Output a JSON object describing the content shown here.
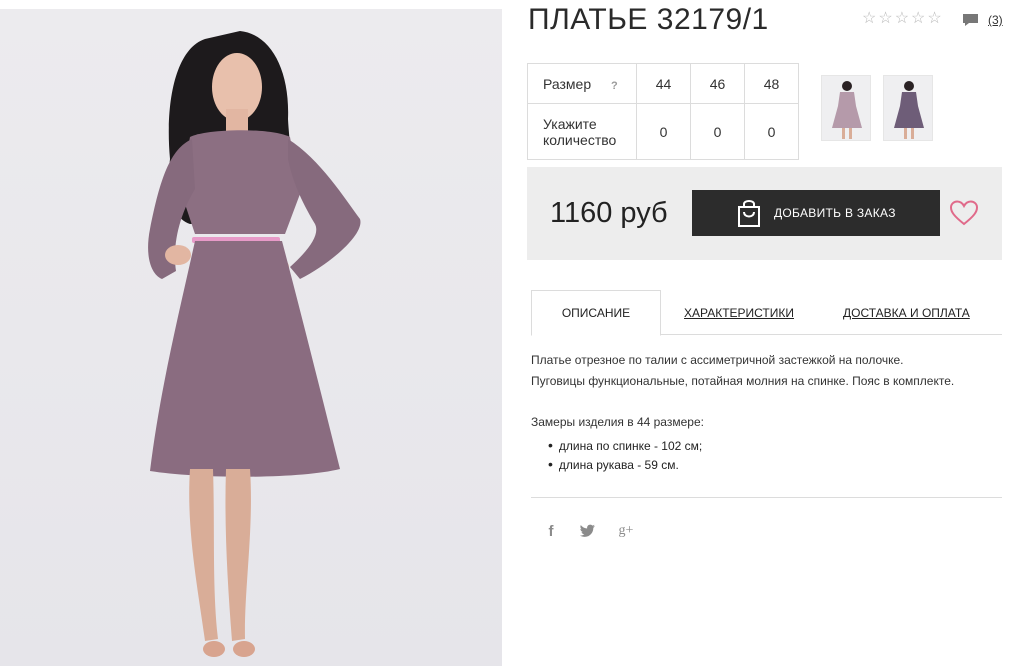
{
  "product": {
    "title": "ПЛАТЬЕ 32179/1",
    "review_count": "(3)"
  },
  "rating": {
    "value": 0,
    "max": 5,
    "star_glyph": "☆"
  },
  "size_table": {
    "size_label": "Размер",
    "help_label": "?",
    "quantity_label_line1": "Укажите",
    "quantity_label_line2": "количество",
    "sizes": [
      "44",
      "46",
      "48"
    ],
    "quantities": [
      "0",
      "0",
      "0"
    ]
  },
  "buy": {
    "price": "1160 руб",
    "add_button_label": "ДОБАВИТЬ В ЗАКАЗ"
  },
  "tabs": [
    {
      "label": "ОПИСАНИЕ",
      "active": true
    },
    {
      "label": "ХАРАКТЕРИСТИКИ",
      "active": false
    },
    {
      "label": "ДОСТАВКА И ОПЛАТА",
      "active": false
    }
  ],
  "description": {
    "line1": "Платье отрезное по талии с ассиметричной застежкой на полочке.",
    "line2": "Пуговицы функциональные, потайная молния на спинке. Пояс в комплекте.",
    "measurements_title": "Замеры изделия в 44 размере:",
    "measurements": [
      "длина по спинке - 102 см;",
      "длина рукава - 59 см."
    ]
  },
  "social": {
    "facebook": "f",
    "googleplus": "g+"
  },
  "colors": {
    "dress": "#8c6f82",
    "belt": "#e79ac8",
    "button_bg": "#2c2c2c",
    "heart": "#e06a8a",
    "buy_box_bg": "#ededed",
    "photo_bg": "#e9e8ec"
  },
  "icons": {
    "bag": "shopping-bag-icon",
    "heart": "heart-outline-icon",
    "comment": "comment-bubble-icon",
    "star": "star-outline-icon"
  }
}
